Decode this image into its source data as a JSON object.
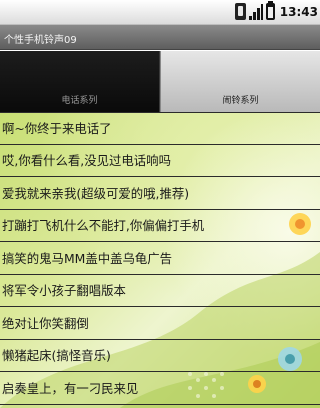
{
  "status_bar": {
    "time": "13:43",
    "icons": [
      "phone-vibrate-icon",
      "signal-icon",
      "battery-icon"
    ]
  },
  "title_bar": {
    "title": "个性手机铃声09"
  },
  "tabs": [
    {
      "label": "电话系列",
      "selected": true
    },
    {
      "label": "闹铃系列",
      "selected": false
    }
  ],
  "list": {
    "items": [
      "啊~你终于来电话了",
      "哎,你看什么看,没见过电话响吗",
      "爱我就来亲我(超级可爱的哦,推荐)",
      "打蹦打飞机什么不能打,你偏偏打手机",
      "搞笑的鬼马MM盖中盖乌龟广告",
      "将军令小孩子翻唱版本",
      "绝对让你笑翻倒",
      "懒猪起床(搞怪音乐)",
      "启奏皇上，有一刁民来见"
    ]
  },
  "theme": {
    "list_bg": "#dbe99a",
    "active_tab_bg": "#111111",
    "inactive_tab_bg": "#c9c9c9"
  }
}
